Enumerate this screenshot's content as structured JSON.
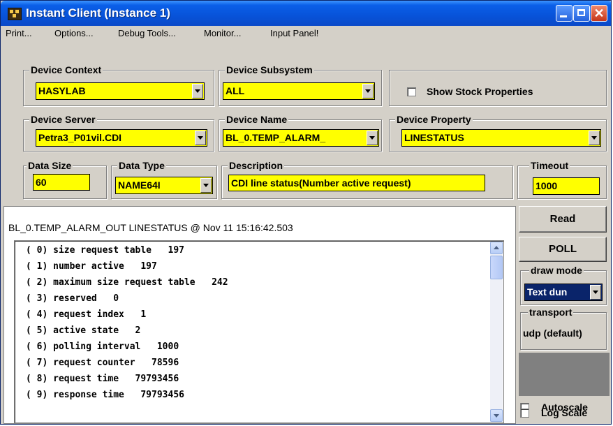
{
  "window": {
    "title": "Instant Client (Instance  1)"
  },
  "menu": [
    "Print...",
    "Options...",
    "Debug Tools...",
    "Monitor...",
    "Input Panel!"
  ],
  "device_context": {
    "label": "Device Context",
    "value": "HASYLAB"
  },
  "device_subsystem": {
    "label": "Device Subsystem",
    "value": "ALL"
  },
  "show_stock": {
    "label": "Show Stock Properties",
    "checked": false
  },
  "device_server": {
    "label": "Device Server",
    "value": "Petra3_P01vil.CDI"
  },
  "device_name": {
    "label": "Device Name",
    "value": "BL_0.TEMP_ALARM_"
  },
  "device_property": {
    "label": "Device Property",
    "value": "LINESTATUS"
  },
  "data_size": {
    "label": "Data Size",
    "value": "60"
  },
  "data_type": {
    "label": "Data Type",
    "value": "NAME64I"
  },
  "description": {
    "label": "Description",
    "value": "CDI line status(Number active request)"
  },
  "timeout": {
    "label": "Timeout",
    "value": "1000"
  },
  "output": {
    "title": "BL_0.TEMP_ALARM_OUT LINESTATUS @ Nov 11 15:16:42.503",
    "lines": [
      "( 0) size request table   197",
      "( 1) number active   197",
      "( 2) maximum size request table   242",
      "( 3) reserved   0",
      "( 4) request index   1",
      "( 5) active state   2",
      "( 6) polling interval   1000",
      "( 7) request counter   78596",
      "( 8) request time   79793456",
      "( 9) response time   79793456"
    ]
  },
  "side": {
    "read": "Read",
    "poll": "POLL",
    "draw_mode": {
      "label": "draw mode",
      "value": "Text dun"
    },
    "transport": {
      "label": "transport",
      "value": "udp (default)"
    },
    "autoscale": "Autoscale",
    "log_scale": "Log Scale"
  },
  "colors": {
    "field": "#ffff00",
    "titlebar": "#0a5fe8",
    "face": "#d4d0c8"
  }
}
